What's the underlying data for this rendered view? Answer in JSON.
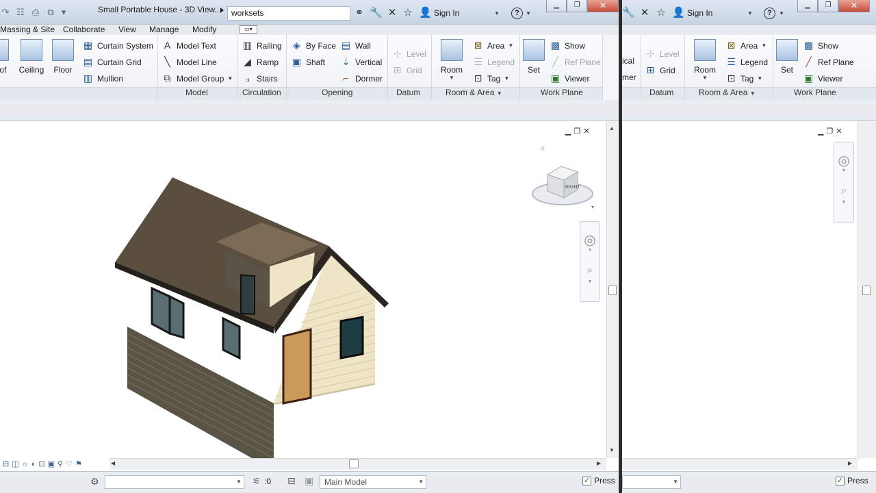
{
  "left": {
    "title": "Small Portable House - 3D View...",
    "search_value": "worksets",
    "sign_in": "Sign In",
    "tabs": [
      "Massing & Site",
      "Collaborate",
      "View",
      "Manage",
      "Modify"
    ],
    "build": {
      "roof_label": "oof",
      "ceiling_label": "Ceiling",
      "floor_label": "Floor",
      "curtain_system": "Curtain System",
      "curtain_grid": "Curtain Grid",
      "mullion": "Mullion"
    },
    "model": {
      "model_text": "Model Text",
      "model_line": "Model Line",
      "model_group": "Model Group",
      "panel_label": "Model"
    },
    "circulation": {
      "railing": "Railing",
      "ramp": "Ramp",
      "stairs": "Stairs",
      "panel_label": "Circulation"
    },
    "opening": {
      "by_face": "By Face",
      "shaft": "Shaft",
      "wall": "Wall",
      "vertical": "Vertical",
      "dormer": "Dormer",
      "panel_label": "Opening"
    },
    "datum": {
      "level": "Level",
      "grid": "Grid",
      "panel_label": "Datum"
    },
    "room_area": {
      "room": "Room",
      "area": "Area",
      "legend": "Legend",
      "tag": "Tag",
      "panel_label": "Room & Area"
    },
    "work_plane": {
      "set": "Set",
      "show": "Show",
      "ref_plane": "Ref Plane",
      "viewer": "Viewer",
      "panel_label": "Work Plane"
    },
    "viewcube_face": "RIGHT",
    "status": {
      "count": ":0",
      "workset": "Main Model",
      "press": "Press"
    }
  },
  "right": {
    "sign_in": "Sign In",
    "build_partial_1": "ical",
    "build_partial_2": "mer",
    "datum": {
      "level": "Level",
      "grid": "Grid",
      "panel_label": "Datum"
    },
    "room_area": {
      "room": "Room",
      "area": "Area",
      "legend": "Legend",
      "tag": "Tag",
      "panel_label": "Room & Area"
    },
    "work_plane": {
      "set": "Set",
      "show": "Show",
      "ref_plane": "Ref Plane",
      "viewer": "Viewer",
      "panel_label": "Work Plane"
    },
    "status": {
      "press": "Press"
    }
  },
  "icons": {
    "window_min": "minimize-icon",
    "window_restore": "restore-icon",
    "window_close": "close-icon"
  }
}
